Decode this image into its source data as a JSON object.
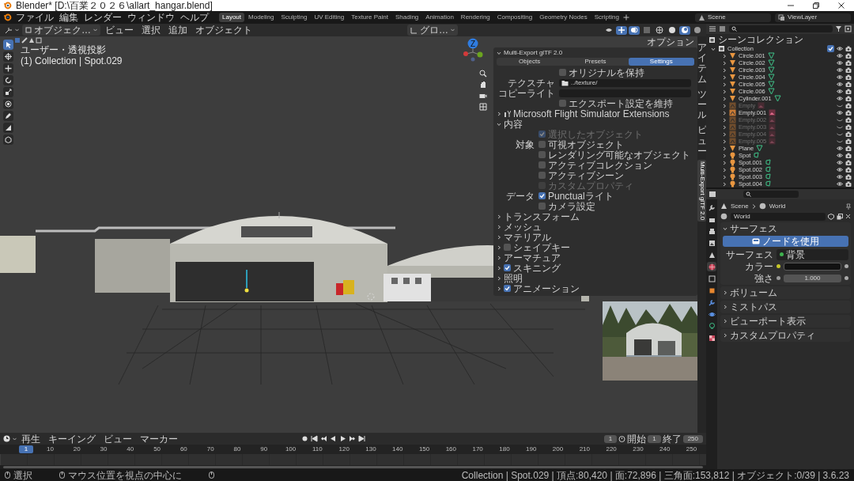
{
  "window": {
    "title": "Blender* [D:\\百業２０２６\\allart_hangar.blend]"
  },
  "top_bar": {
    "menus": [
      "ファイル",
      "編集",
      "レンダー",
      "ウィンドウ",
      "ヘルプ"
    ],
    "workspaces": [
      {
        "label": "Layout",
        "selected": true
      },
      {
        "label": "Modeling",
        "selected": false
      },
      {
        "label": "Sculpting",
        "selected": false
      },
      {
        "label": "UV Editing",
        "selected": false
      },
      {
        "label": "Texture Paint",
        "selected": false
      },
      {
        "label": "Shading",
        "selected": false
      },
      {
        "label": "Animation",
        "selected": false
      },
      {
        "label": "Rendering",
        "selected": false
      },
      {
        "label": "Compositing",
        "selected": false
      },
      {
        "label": "Geometry Nodes",
        "selected": false
      },
      {
        "label": "Scripting",
        "selected": false
      }
    ],
    "scene": "Scene",
    "view_layer": "ViewLayer"
  },
  "viewport": {
    "mode": "オブジェク…",
    "menus": [
      "ビュー",
      "選択",
      "追加",
      "オブジェクト"
    ],
    "orientation": "グロ…",
    "options": "オプション",
    "view_name": "ユーザー・透視投影",
    "active_object": "(1) Collection | Spot.029",
    "axis_label": "Z",
    "tools": [
      {
        "selected": true
      },
      {
        "selected": false
      },
      {
        "selected": false
      },
      {
        "selected": false
      },
      {
        "selected": false
      },
      {
        "selected": false
      },
      {
        "selected": false
      },
      {
        "selected": false
      },
      {
        "selected": false
      }
    ],
    "sidebar_tabs": [
      {
        "label": "アイテム",
        "kind": "stacked",
        "selected": false
      },
      {
        "label": "ツール",
        "kind": "stacked",
        "selected": false
      },
      {
        "label": "ビュー",
        "kind": "stacked",
        "selected": false
      },
      {
        "label": "Multi-Export glTF 2.0",
        "kind": "rotated",
        "selected": true
      }
    ],
    "export_panel": {
      "title": "Multi-Export glTF 2.0",
      "expanded": true,
      "tabs": [
        {
          "label": "Objects",
          "selected": false
        },
        {
          "label": "Presets",
          "selected": false
        },
        {
          "label": "Settings",
          "selected": true
        }
      ],
      "settings": [
        {
          "kind": "checkbox",
          "label": "オリジナルを保持",
          "checked": false
        },
        {
          "kind": "path",
          "label": "テクスチャ",
          "value": "../texture/"
        },
        {
          "kind": "text",
          "label": "コピーライト"
        },
        {
          "kind": "checkbox",
          "label": "エクスポート設定を維持",
          "checked": false
        }
      ],
      "sections": [
        {
          "title": "Microsoft Flight Simulator Extensions",
          "kind": "plugin",
          "expanded": false
        },
        {
          "title": "内容",
          "kind": "plain",
          "expanded": true,
          "options": [
            {
              "label": "選択したオブジェクト",
              "checked": true,
              "disabled": true
            },
            {
              "group": "対象",
              "label": "可視オブジェクト",
              "checked": false,
              "disabled": false
            },
            {
              "label": "レンダリング可能なオブジェクト",
              "checked": false,
              "disabled": false
            },
            {
              "label": "アクティブコレクション",
              "checked": false,
              "disabled": false
            },
            {
              "label": "アクティブシーン",
              "checked": false,
              "disabled": false
            },
            {
              "label": "カスタムプロパティ",
              "checked": false,
              "disabled": true
            },
            {
              "group": "データ",
              "label": "Punctualライト",
              "checked": true,
              "disabled": false
            },
            {
              "label": "カメラ設定",
              "checked": false,
              "disabled": false
            }
          ]
        }
      ],
      "subpanels": [
        {
          "title": "トランスフォーム",
          "kind": "plain",
          "expanded": false
        },
        {
          "title": "メッシュ",
          "kind": "plain",
          "expanded": false
        },
        {
          "title": "マテリアル",
          "kind": "plain",
          "expanded": false
        },
        {
          "title": "シェイプキー",
          "kind": "checkbox",
          "checked": false,
          "expanded": false
        },
        {
          "title": "アーマチュア",
          "kind": "plain",
          "expanded": false
        },
        {
          "title": "スキニング",
          "kind": "checkbox",
          "checked": true,
          "expanded": false
        },
        {
          "title": "照明",
          "kind": "plain",
          "expanded": false
        },
        {
          "title": "アニメーション",
          "kind": "checkbox",
          "checked": true,
          "expanded": false
        }
      ]
    }
  },
  "timeline": {
    "menus": [
      "再生",
      "キーイング",
      "ビュー",
      "マーカー"
    ],
    "current_frame": "1",
    "start_label": "開始",
    "start": "1",
    "end_label": "終了",
    "end": "250",
    "playhead": "1",
    "ruler": [
      "10",
      "20",
      "30",
      "40",
      "50",
      "60",
      "70",
      "80",
      "90",
      "100",
      "110",
      "120",
      "130",
      "140",
      "150",
      "160",
      "170",
      "180",
      "190",
      "200",
      "210",
      "220",
      "230",
      "240",
      "250"
    ]
  },
  "outliner": {
    "root": "シーンコレクション",
    "collection": {
      "name": "Collection",
      "expanded": true,
      "checked": true
    },
    "items": [
      {
        "name": "Circle.001",
        "kind": "mesh",
        "hidden": false
      },
      {
        "name": "Circle.002",
        "kind": "mesh",
        "hidden": false
      },
      {
        "name": "Circle.003",
        "kind": "mesh",
        "hidden": false
      },
      {
        "name": "Circle.004",
        "kind": "mesh",
        "hidden": false
      },
      {
        "name": "Circle.005",
        "kind": "mesh",
        "hidden": false
      },
      {
        "name": "Circle.006",
        "kind": "mesh",
        "hidden": false
      },
      {
        "name": "Cylinder.001",
        "kind": "mesh",
        "hidden": false
      },
      {
        "name": "Empty",
        "kind": "empty",
        "hidden": true
      },
      {
        "name": "Empty.001",
        "kind": "empty",
        "hidden": false
      },
      {
        "name": "Empty.002",
        "kind": "empty",
        "hidden": true
      },
      {
        "name": "Empty.003",
        "kind": "empty",
        "hidden": true
      },
      {
        "name": "Empty.004",
        "kind": "empty",
        "hidden": true
      },
      {
        "name": "Empty.005",
        "kind": "empty",
        "hidden": true
      },
      {
        "name": "Plane",
        "kind": "mesh",
        "hidden": false
      },
      {
        "name": "Spot",
        "kind": "light",
        "hidden": false
      },
      {
        "name": "Spot.001",
        "kind": "light",
        "hidden": false
      },
      {
        "name": "Spot.002",
        "kind": "light",
        "hidden": false
      },
      {
        "name": "Spot.003",
        "kind": "light",
        "hidden": false
      },
      {
        "name": "Spot.004",
        "kind": "light",
        "hidden": false
      }
    ]
  },
  "properties": {
    "tabs": [
      {
        "selected": false
      },
      {
        "selected": false
      },
      {
        "selected": false
      },
      {
        "selected": false
      },
      {
        "selected": false
      },
      {
        "selected": true
      },
      {
        "selected": false
      },
      {
        "selected": false
      },
      {
        "selected": false
      },
      {
        "selected": false
      },
      {
        "selected": false
      },
      {
        "selected": false
      }
    ],
    "breadcrumb": [
      "Scene",
      "World"
    ],
    "world": "World",
    "panels": [
      {
        "title": "サーフェス",
        "expanded": true,
        "use_nodes": "ノードを使用",
        "fields": [
          {
            "kind": "socket",
            "label": "サーフェス",
            "value": "背景",
            "color": "#3fb24f"
          },
          {
            "kind": "color",
            "label": "カラー",
            "color": "#c7c729"
          },
          {
            "kind": "number",
            "label": "強さ",
            "value": "1.000"
          }
        ]
      },
      {
        "title": "ボリューム",
        "expanded": false
      },
      {
        "title": "ミストパス",
        "expanded": false
      },
      {
        "title": "ビューポート表示",
        "expanded": false
      },
      {
        "title": "カスタムプロパティ",
        "expanded": false
      }
    ]
  },
  "status_bar": {
    "hints": [
      "選択",
      "マウス位置を視点の中心に"
    ],
    "stats": "Collection | Spot.029 | 頂点:80,420 | 面:72,896 | 三角面:153,812 | オブジェクト:0/39 | 3.6.23"
  }
}
